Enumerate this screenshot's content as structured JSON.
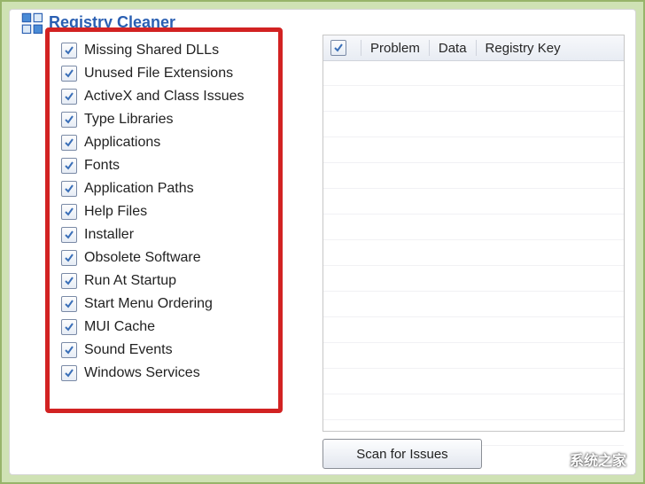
{
  "title": "Registry Cleaner",
  "categories": [
    "Missing Shared DLLs",
    "Unused File Extensions",
    "ActiveX and Class Issues",
    "Type Libraries",
    "Applications",
    "Fonts",
    "Application Paths",
    "Help Files",
    "Installer",
    "Obsolete Software",
    "Run At Startup",
    "Start Menu Ordering",
    "MUI Cache",
    "Sound Events",
    "Windows Services"
  ],
  "columns": [
    "Problem",
    "Data",
    "Registry Key"
  ],
  "scan_label": "Scan for Issues",
  "watermark": "系统之家"
}
